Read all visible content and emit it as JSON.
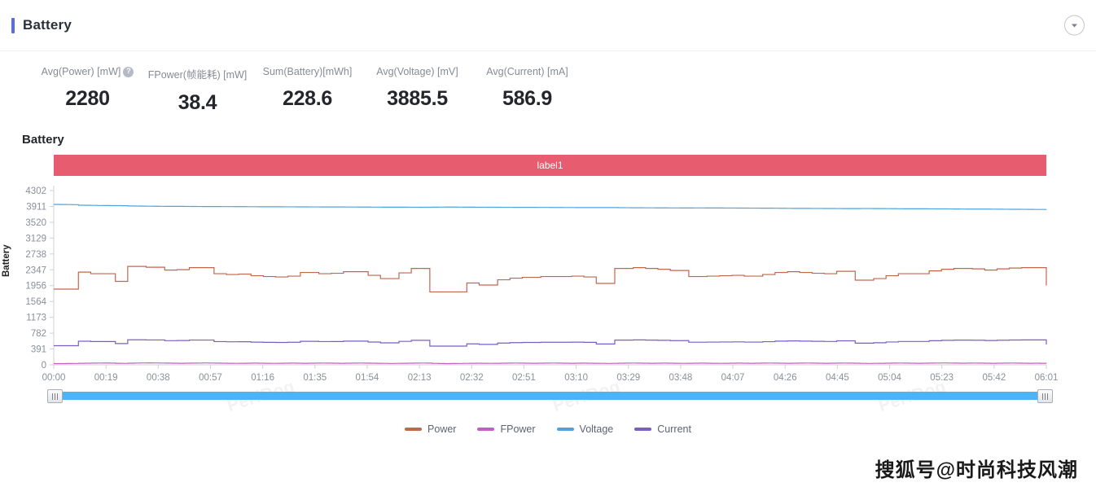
{
  "header": {
    "title": "Battery",
    "collapse_icon": "chevron-down-icon"
  },
  "metrics": [
    {
      "label": "Avg(Power) [mW]",
      "value": "2280",
      "has_help": true,
      "help_icon": "question-circle-icon"
    },
    {
      "label": "FPower(帧能耗) [mW]",
      "value": "38.4",
      "has_help": false
    },
    {
      "label": "Sum(Battery)[mWh]",
      "value": "228.6",
      "has_help": false
    },
    {
      "label": "Avg(Voltage) [mV]",
      "value": "3885.5",
      "has_help": false
    },
    {
      "label": "Avg(Current) [mA]",
      "value": "586.9",
      "has_help": false
    }
  ],
  "chart_title": "Battery",
  "label_band": {
    "text": "label1",
    "color": "#e75c6e"
  },
  "datazoom": {
    "start_percent": 0,
    "end_percent": 100,
    "handle_icon": "grip-handle-icon"
  },
  "watermarks": {
    "perfdog": "PerfDog",
    "sohu": "搜狐号@时尚科技风潮"
  },
  "chart_data": {
    "type": "line",
    "title": "Battery",
    "xlabel": "",
    "ylabel": "Battery",
    "grid": false,
    "legend_position": "bottom",
    "ylim": [
      0,
      4302
    ],
    "yticks": [
      0,
      391,
      782,
      1173,
      1564,
      1956,
      2347,
      2738,
      3129,
      3520,
      3911,
      4302
    ],
    "xticks": [
      "00:00",
      "00:19",
      "00:38",
      "00:57",
      "01:16",
      "01:35",
      "01:54",
      "02:13",
      "02:32",
      "02:51",
      "03:10",
      "03:29",
      "03:48",
      "04:07",
      "04:26",
      "04:45",
      "05:04",
      "05:23",
      "05:42",
      "06:01"
    ],
    "series": [
      {
        "name": "Power",
        "unit": "mW",
        "color": "#c0674f",
        "values": [
          1870,
          1870,
          1870,
          1870,
          2290,
          2290,
          2250,
          2250,
          2250,
          2250,
          2060,
          2060,
          2430,
          2430,
          2430,
          2410,
          2410,
          2410,
          2340,
          2340,
          2350,
          2350,
          2400,
          2400,
          2400,
          2400,
          2250,
          2250,
          2230,
          2230,
          2240,
          2240,
          2200,
          2200,
          2180,
          2180,
          2170,
          2170,
          2190,
          2190,
          2280,
          2280,
          2280,
          2250,
          2250,
          2260,
          2260,
          2300,
          2300,
          2300,
          2300,
          2210,
          2210,
          2130,
          2130,
          2130,
          2270,
          2270,
          2380,
          2380,
          2380,
          1800,
          1800,
          1800,
          1800,
          1800,
          1800,
          2020,
          2020,
          1970,
          1970,
          1970,
          2100,
          2100,
          2140,
          2140,
          2160,
          2160,
          2160,
          2180,
          2180,
          2180,
          2180,
          2180,
          2190,
          2190,
          2170,
          2170,
          2010,
          2010,
          2010,
          2380,
          2380,
          2380,
          2400,
          2400,
          2380,
          2380,
          2360,
          2360,
          2330,
          2330,
          2330,
          2180,
          2180,
          2180,
          2190,
          2190,
          2200,
          2200,
          2210,
          2210,
          2190,
          2190,
          2190,
          2230,
          2230,
          2280,
          2280,
          2300,
          2300,
          2280,
          2280,
          2260,
          2260,
          2250,
          2250,
          2310,
          2310,
          2310,
          2090,
          2090,
          2090,
          2130,
          2130,
          2200,
          2200,
          2250,
          2250,
          2250,
          2250,
          2250,
          2320,
          2320,
          2360,
          2360,
          2380,
          2380,
          2380,
          2370,
          2370,
          2340,
          2340,
          2370,
          2370,
          2390,
          2390,
          2400,
          2400,
          2400,
          2400,
          1960
        ]
      },
      {
        "name": "FPower",
        "unit": "mW",
        "color": "#c45fbd",
        "values": [
          30,
          30,
          32,
          34,
          38,
          40,
          42,
          44,
          45,
          42,
          38,
          36,
          40,
          44,
          46,
          48,
          46,
          44,
          42,
          40,
          38,
          40,
          42,
          44,
          46,
          44,
          42,
          40,
          38,
          36,
          38,
          40,
          42,
          40,
          38,
          36,
          38,
          40,
          42,
          40,
          38,
          40,
          42,
          44,
          42,
          40,
          38,
          40,
          42,
          44,
          42,
          40,
          38,
          36,
          34,
          36,
          38,
          40,
          42,
          44,
          42,
          36,
          32,
          30,
          32,
          34,
          36,
          38,
          40,
          38,
          36,
          38,
          40,
          42,
          44,
          42,
          40,
          38,
          40,
          42,
          44,
          42,
          40,
          38,
          40,
          42,
          40,
          38,
          36,
          34,
          36,
          40,
          42,
          44,
          42,
          40,
          38,
          40,
          42,
          40,
          38,
          36,
          38,
          40,
          42,
          40,
          38,
          36,
          38,
          40,
          42,
          40,
          38,
          40,
          42,
          44,
          42,
          40,
          38,
          40,
          42,
          44,
          42,
          40,
          38,
          40,
          42,
          44,
          42,
          40,
          36,
          34,
          36,
          38,
          40,
          42,
          44,
          42,
          40,
          38,
          40,
          42,
          44,
          46,
          44,
          42,
          40,
          42,
          44,
          42,
          40,
          38,
          40,
          42,
          44,
          42,
          40,
          38,
          40,
          38,
          36
        ]
      },
      {
        "name": "Voltage",
        "unit": "mV",
        "color": "#4ea2e0",
        "values": [
          3960,
          3958,
          3956,
          3954,
          3940,
          3938,
          3936,
          3934,
          3932,
          3930,
          3930,
          3928,
          3922,
          3920,
          3918,
          3916,
          3915,
          3914,
          3913,
          3912,
          3912,
          3911,
          3910,
          3909,
          3908,
          3907,
          3907,
          3906,
          3906,
          3905,
          3905,
          3904,
          3904,
          3903,
          3903,
          3902,
          3902,
          3901,
          3901,
          3900,
          3900,
          3899,
          3899,
          3898,
          3898,
          3897,
          3897,
          3896,
          3896,
          3895,
          3895,
          3894,
          3894,
          3893,
          3893,
          3892,
          3892,
          3891,
          3891,
          3890,
          3890,
          3893,
          3894,
          3895,
          3895,
          3894,
          3893,
          3892,
          3891,
          3891,
          3890,
          3890,
          3889,
          3889,
          3888,
          3888,
          3887,
          3887,
          3886,
          3886,
          3885,
          3885,
          3884,
          3884,
          3883,
          3883,
          3882,
          3882,
          3883,
          3883,
          3882,
          3880,
          3879,
          3878,
          3877,
          3876,
          3876,
          3875,
          3875,
          3874,
          3874,
          3873,
          3873,
          3874,
          3874,
          3873,
          3872,
          3872,
          3871,
          3871,
          3870,
          3870,
          3869,
          3869,
          3868,
          3867,
          3866,
          3865,
          3864,
          3863,
          3862,
          3862,
          3861,
          3861,
          3860,
          3860,
          3859,
          3858,
          3857,
          3857,
          3859,
          3859,
          3858,
          3857,
          3856,
          3855,
          3854,
          3853,
          3853,
          3852,
          3852,
          3851,
          3850,
          3849,
          3848,
          3847,
          3846,
          3845,
          3845,
          3844,
          3844,
          3843,
          3842,
          3841,
          3840,
          3839,
          3838,
          3837,
          3836,
          3836,
          3838
        ]
      },
      {
        "name": "Current",
        "unit": "mA",
        "color": "#7b5ec4",
        "values": [
          472,
          472,
          472,
          472,
          583,
          583,
          575,
          575,
          575,
          575,
          525,
          525,
          618,
          618,
          618,
          614,
          614,
          614,
          597,
          597,
          600,
          600,
          612,
          612,
          612,
          612,
          574,
          574,
          569,
          569,
          571,
          571,
          561,
          561,
          556,
          556,
          553,
          553,
          558,
          558,
          581,
          581,
          581,
          574,
          574,
          576,
          576,
          586,
          586,
          586,
          586,
          563,
          563,
          543,
          543,
          543,
          579,
          579,
          606,
          606,
          606,
          462,
          462,
          462,
          462,
          462,
          462,
          518,
          518,
          505,
          505,
          505,
          538,
          538,
          548,
          548,
          553,
          553,
          553,
          558,
          558,
          558,
          558,
          558,
          561,
          561,
          556,
          556,
          515,
          515,
          515,
          610,
          610,
          610,
          616,
          616,
          610,
          610,
          605,
          605,
          598,
          598,
          598,
          559,
          559,
          559,
          562,
          562,
          564,
          564,
          567,
          567,
          562,
          562,
          562,
          572,
          572,
          585,
          585,
          590,
          590,
          585,
          585,
          580,
          580,
          577,
          577,
          593,
          593,
          593,
          536,
          536,
          536,
          546,
          546,
          564,
          564,
          577,
          577,
          577,
          577,
          577,
          595,
          595,
          605,
          605,
          610,
          610,
          610,
          608,
          608,
          600,
          600,
          608,
          608,
          613,
          613,
          616,
          616,
          616,
          616,
          503
        ]
      }
    ]
  },
  "legend": [
    {
      "name": "Power",
      "color": "#c0674f"
    },
    {
      "name": "FPower",
      "color": "#c45fbd"
    },
    {
      "name": "Voltage",
      "color": "#4ea2e0"
    },
    {
      "name": "Current",
      "color": "#7b5ec4"
    }
  ]
}
